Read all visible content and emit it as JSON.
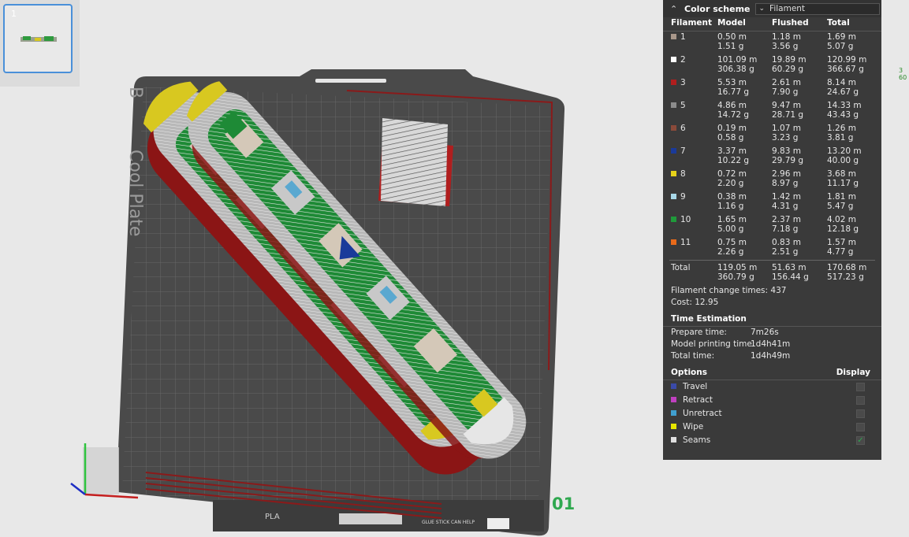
{
  "thumbnails": {
    "items": [
      {
        "number": "1"
      }
    ]
  },
  "plate": {
    "label": "Cool Plate",
    "label_prefix": "B",
    "number": "01",
    "bottom_text": "PLA",
    "bottom_note": "GLUE STICK CAN HELP"
  },
  "side_readout": [
    "3",
    "60"
  ],
  "legend": {
    "header_title": "Color scheme",
    "scheme_value": "Filament",
    "columns": [
      "Filament",
      "Model",
      "Flushed",
      "Total"
    ],
    "rows": [
      {
        "id": "1",
        "color": "#a8978a",
        "model": [
          "0.50 m",
          "1.51 g"
        ],
        "flushed": [
          "1.18 m",
          "3.56 g"
        ],
        "total": [
          "1.69 m",
          "5.07 g"
        ]
      },
      {
        "id": "2",
        "color": "#ffffff",
        "model": [
          "101.09 m",
          "306.38 g"
        ],
        "flushed": [
          "19.89 m",
          "60.29 g"
        ],
        "total": [
          "120.99 m",
          "366.67 g"
        ]
      },
      {
        "id": "3",
        "color": "#b01e1e",
        "model": [
          "5.53 m",
          "16.77 g"
        ],
        "flushed": [
          "2.61 m",
          "7.90 g"
        ],
        "total": [
          "8.14 m",
          "24.67 g"
        ]
      },
      {
        "id": "5",
        "color": "#8c8c8c",
        "model": [
          "4.86 m",
          "14.72 g"
        ],
        "flushed": [
          "9.47 m",
          "28.71 g"
        ],
        "total": [
          "14.33 m",
          "43.43 g"
        ]
      },
      {
        "id": "6",
        "color": "#8a4a3a",
        "model": [
          "0.19 m",
          "0.58 g"
        ],
        "flushed": [
          "1.07 m",
          "3.23 g"
        ],
        "total": [
          "1.26 m",
          "3.81 g"
        ]
      },
      {
        "id": "7",
        "color": "#1a3a9a",
        "model": [
          "3.37 m",
          "10.22 g"
        ],
        "flushed": [
          "9.83 m",
          "29.79 g"
        ],
        "total": [
          "13.20 m",
          "40.00 g"
        ]
      },
      {
        "id": "8",
        "color": "#e6d21a",
        "model": [
          "0.72 m",
          "2.20 g"
        ],
        "flushed": [
          "2.96 m",
          "8.97 g"
        ],
        "total": [
          "3.68 m",
          "11.17 g"
        ]
      },
      {
        "id": "9",
        "color": "#a8d8e8",
        "model": [
          "0.38 m",
          "1.16 g"
        ],
        "flushed": [
          "1.42 m",
          "4.31 g"
        ],
        "total": [
          "1.81 m",
          "5.47 g"
        ]
      },
      {
        "id": "10",
        "color": "#1f9a3a",
        "model": [
          "1.65 m",
          "5.00 g"
        ],
        "flushed": [
          "2.37 m",
          "7.18 g"
        ],
        "total": [
          "4.02 m",
          "12.18 g"
        ]
      },
      {
        "id": "11",
        "color": "#e86a1a",
        "model": [
          "0.75 m",
          "2.26 g"
        ],
        "flushed": [
          "0.83 m",
          "2.51 g"
        ],
        "total": [
          "1.57 m",
          "4.77 g"
        ]
      }
    ],
    "total": {
      "label": "Total",
      "model": [
        "119.05 m",
        "360.79 g"
      ],
      "flushed": [
        "51.63 m",
        "156.44 g"
      ],
      "total": [
        "170.68 m",
        "517.23 g"
      ]
    },
    "filament_change_label": "Filament change times:",
    "filament_change_value": "437",
    "cost_label": "Cost:",
    "cost_value": "12.95"
  },
  "time_estimation": {
    "title": "Time Estimation",
    "items": [
      {
        "label": "Prepare time:",
        "value": "7m26s"
      },
      {
        "label": "Model printing time:",
        "value": "1d4h41m"
      },
      {
        "label": "Total time:",
        "value": "1d4h49m"
      }
    ]
  },
  "options": {
    "title": "Options",
    "display_label": "Display",
    "items": [
      {
        "label": "Travel",
        "color": "#3a4aa8",
        "checked": false
      },
      {
        "label": "Retract",
        "color": "#c040c0",
        "checked": false
      },
      {
        "label": "Unretract",
        "color": "#40a0d0",
        "checked": false
      },
      {
        "label": "Wipe",
        "color": "#e6e600",
        "checked": false
      },
      {
        "label": "Seams",
        "color": "#e0e0e0",
        "checked": true
      }
    ]
  }
}
